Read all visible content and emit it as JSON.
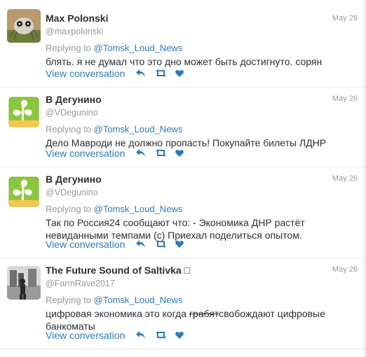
{
  "feed": {
    "common": {
      "replying_prefix": "Replying to",
      "view_conversation": "View conversation"
    },
    "tweets": [
      {
        "name": "Max Polonski",
        "handle": "@maxpolonski",
        "date": "May 26",
        "replying_to": "@Tomsk_Loud_News",
        "text": "блять. я не думал что это дно может быть достигнуто. сорян"
      },
      {
        "name": "В Дегунино",
        "handle": "@VDegunino",
        "date": "May 26",
        "replying_to": "@Tomsk_Loud_News",
        "text": "Дело Мавроди не должно пропасть! Покупайте билеты ЛДНР"
      },
      {
        "name": "В Дегунино",
        "handle": "@VDegunino",
        "date": "May 26",
        "replying_to": "@Tomsk_Loud_News",
        "text": "Так по Россия24 сообщают что: - Экономика ДНР растёт невиданными темпами (с) Приехал поделиться опытом."
      },
      {
        "name": "The Future Sound of Saltivka □",
        "handle": "@FarmRave2017",
        "date": "May 26",
        "replying_to": "@Tomsk_Loud_News",
        "text_before": "цифровая экономика это когда ",
        "text_struck": "грабят",
        "text_after": "свобождают цифровые банкоматы"
      }
    ],
    "colors": {
      "link": "#2b7bb9",
      "meta": "#999999",
      "text": "#292f33",
      "avatar_green": "#8cc63e"
    },
    "icons": [
      "reply-icon",
      "retweet-icon",
      "like-icon"
    ]
  }
}
